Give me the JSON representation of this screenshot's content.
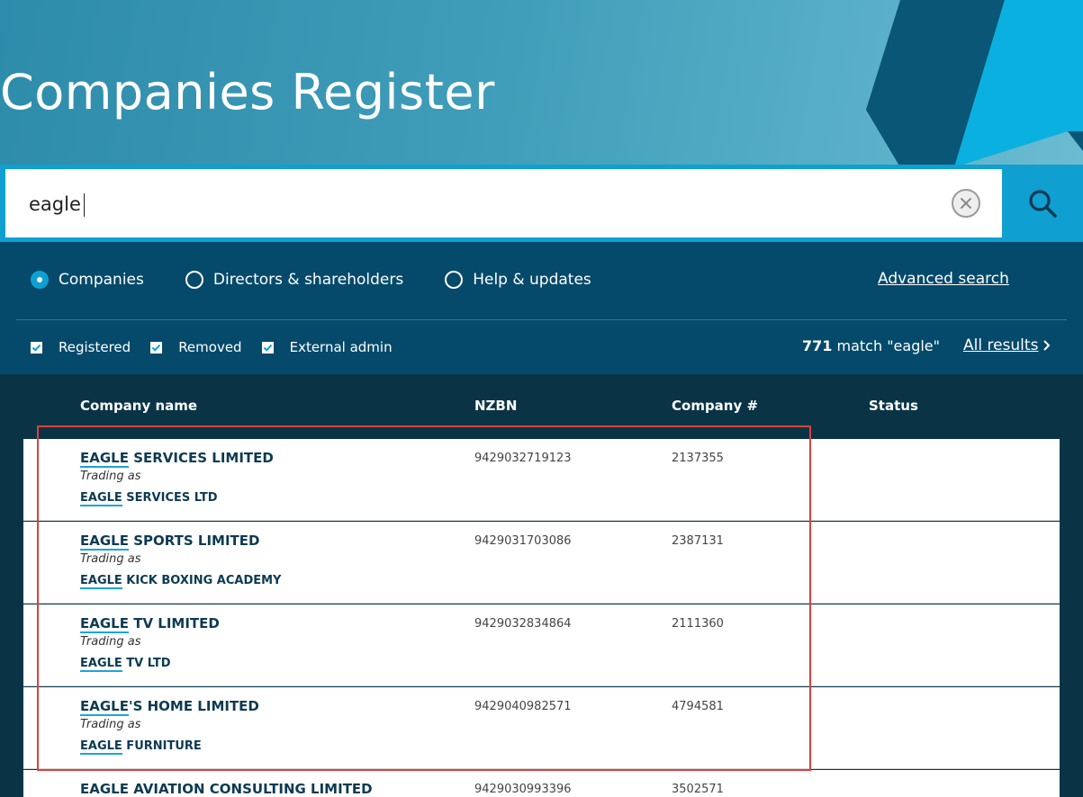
{
  "header": {
    "title": "Companies Register"
  },
  "search": {
    "value": "eagle",
    "placeholder": ""
  },
  "filters": {
    "radios": [
      {
        "label": "Companies",
        "checked": true
      },
      {
        "label": "Directors & shareholders",
        "checked": false
      },
      {
        "label": "Help & updates",
        "checked": false
      }
    ],
    "advanced_search_label": "Advanced search",
    "checkboxes": [
      {
        "label": "Registered",
        "checked": true
      },
      {
        "label": "Removed",
        "checked": true
      },
      {
        "label": "External admin",
        "checked": true
      }
    ],
    "match_count": "771",
    "match_text": "match \"eagle\"",
    "all_results_label": "All results"
  },
  "table": {
    "columns": [
      "Company name",
      "NZBN",
      "Company #",
      "Status"
    ],
    "rows": [
      {
        "name_hl": "EAGLE",
        "name_rest": " SERVICES LIMITED",
        "trading_as": "Trading as",
        "trade_hl": "EAGLE",
        "trade_rest": " SERVICES LTD",
        "nzbn": "9429032719123",
        "company_no": "2137355"
      },
      {
        "name_hl": "EAGLE",
        "name_rest": " SPORTS LIMITED",
        "trading_as": "Trading as",
        "trade_hl": "EAGLE",
        "trade_rest": " KICK BOXING ACADEMY",
        "nzbn": "9429031703086",
        "company_no": "2387131"
      },
      {
        "name_hl": "EAGLE",
        "name_rest": " TV LIMITED",
        "trading_as": "Trading as",
        "trade_hl": "EAGLE",
        "trade_rest": " TV LTD",
        "nzbn": "9429032834864",
        "company_no": "2111360"
      },
      {
        "name_hl": "EAGLE",
        "name_rest": "'S HOME LIMITED",
        "trading_as": "Trading as",
        "trade_hl": "EAGLE",
        "trade_rest": " FURNITURE",
        "nzbn": "9429040982571",
        "company_no": "4794581"
      },
      {
        "name_hl": "EAGLE",
        "name_rest": " AVIATION CONSULTING LIMITED",
        "trading_as": "",
        "trade_hl": "",
        "trade_rest": "",
        "nzbn": "9429030993396",
        "company_no": "3502571"
      }
    ]
  },
  "colors": {
    "accent": "#0f9fd0",
    "panel": "#054a6b",
    "highlight_box": "#d9413f"
  }
}
